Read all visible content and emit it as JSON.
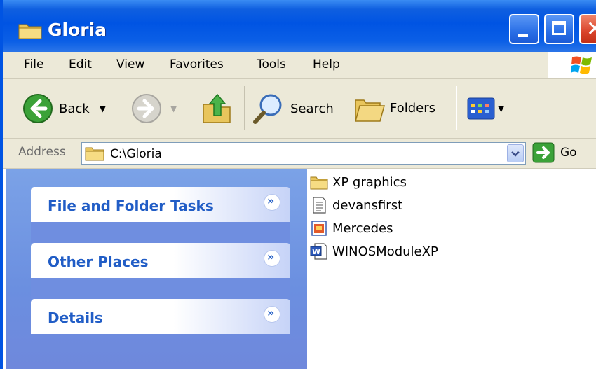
{
  "window": {
    "title": "Gloria",
    "accent_color": "#0054e3",
    "icon": "folder-icon",
    "caption_buttons": [
      "minimize-icon",
      "maximize-icon",
      "close-icon"
    ]
  },
  "menu": {
    "items": [
      "File",
      "Edit",
      "View",
      "Favorites",
      "Tools",
      "Help"
    ],
    "logo": "windows-logo-icon"
  },
  "toolbar": {
    "back_label": "Back",
    "search_label": "Search",
    "folders_label": "Folders",
    "icons": [
      "back-arrow-icon",
      "forward-arrow-icon",
      "up-folder-icon",
      "search-icon",
      "folders-icon",
      "views-icon"
    ]
  },
  "address": {
    "label": "Address",
    "value": "C:\\Gloria",
    "go_label": "Go"
  },
  "taskpane": {
    "background_color": "#6f8ee0",
    "title_color": "#215dc6",
    "groups": [
      {
        "title": "File and Folder Tasks"
      },
      {
        "title": "Other Places"
      },
      {
        "title": "Details"
      }
    ]
  },
  "files": [
    {
      "name": "XP graphics",
      "icon": "folder-icon"
    },
    {
      "name": "devansfirst",
      "icon": "text-document-icon"
    },
    {
      "name": "Mercedes",
      "icon": "image-file-icon"
    },
    {
      "name": "WINOSModuleXP",
      "icon": "word-document-icon"
    }
  ]
}
